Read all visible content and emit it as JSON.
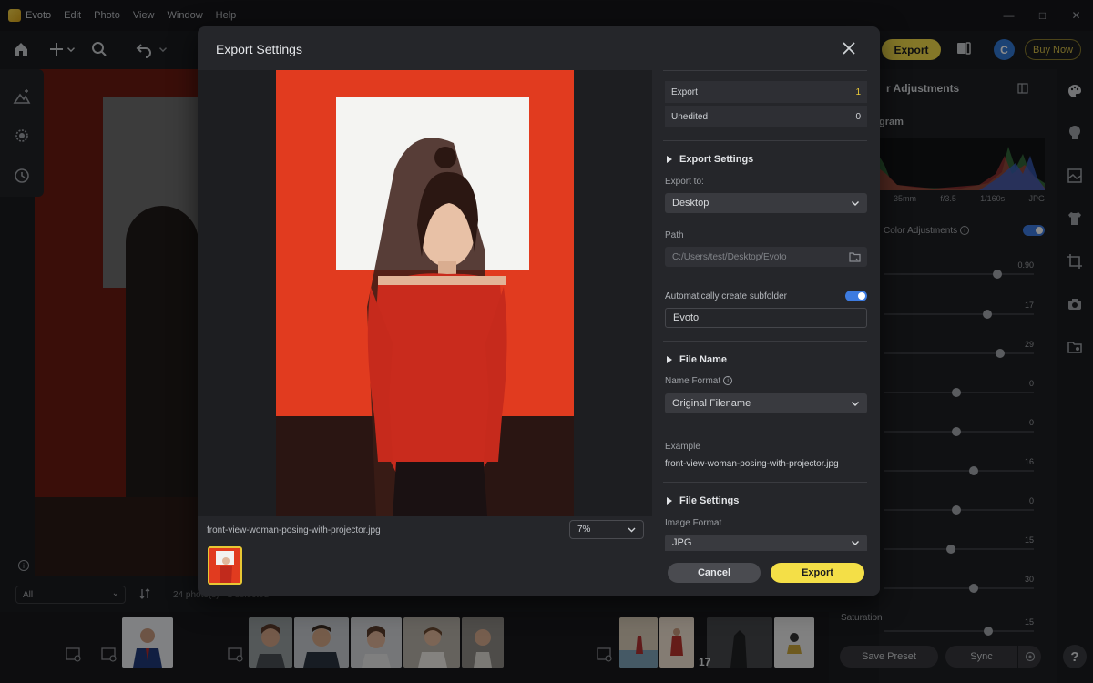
{
  "app": {
    "name": "Evoto",
    "menu": [
      "Edit",
      "Photo",
      "View",
      "Window",
      "Help"
    ],
    "accent": "#f4df47"
  },
  "toolbar": {
    "export_label": "Export",
    "avatar_letter": "C",
    "buy_label": "Buy Now"
  },
  "right_panel": {
    "title": "r Adjustments",
    "subtitle": "gram",
    "histogram_meta": [
      "35mm",
      "f/3.5",
      "1/160s",
      "JPG"
    ],
    "color_label": "Color Adjustments",
    "sliders": [
      {
        "value": "0.90",
        "fraction": 0.78
      },
      {
        "value": "17",
        "fraction": 0.71
      },
      {
        "value": "29",
        "fraction": 0.8
      },
      {
        "value": "0",
        "fraction": 0.5
      },
      {
        "value": "0",
        "fraction": 0.5
      },
      {
        "value": "16",
        "fraction": 0.62
      },
      {
        "value": "0",
        "fraction": 0.5
      },
      {
        "value": "15",
        "fraction": 0.46
      },
      {
        "value": "30",
        "fraction": 0.62
      },
      {
        "value": "15",
        "fraction": 0.72
      }
    ],
    "saturation_label": "Saturation",
    "save_preset_label": "Save Preset",
    "sync_label": "Sync"
  },
  "filter": {
    "selected": "All",
    "photo_count_text": "24 photo(s) · 1 selected"
  },
  "filmstrip": {
    "count": "17"
  },
  "modal": {
    "title": "Export Settings",
    "photo_name": "front-view-woman-posing-with-projector.jpg",
    "zoom": "7%",
    "stats": [
      {
        "label": "Export",
        "value": "1"
      },
      {
        "label": "Unedited",
        "value": "0"
      }
    ],
    "export_settings": {
      "heading": "Export Settings",
      "export_to_label": "Export to:",
      "export_to_value": "Desktop",
      "path_label": "Path",
      "path_value": "C:/Users/test/Desktop/Evoto",
      "subfolder_label": "Automatically create subfolder",
      "subfolder_value": "Evoto"
    },
    "file_name": {
      "heading": "File Name",
      "format_label": "Name Format",
      "format_value": "Original Filename",
      "example_label": "Example",
      "example_value": "front-view-woman-posing-with-projector.jpg"
    },
    "file_settings": {
      "heading": "File Settings",
      "image_format_label": "Image Format",
      "image_format_value": "JPG"
    },
    "cancel_label": "Cancel",
    "export_label": "Export"
  }
}
